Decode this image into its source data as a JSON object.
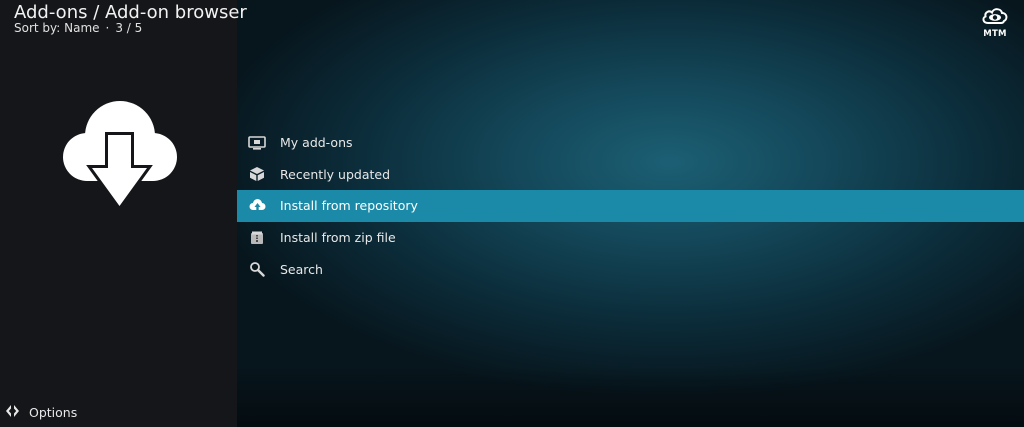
{
  "header": {
    "title": "Add-ons / Add-on browser",
    "sort_label": "Sort by: Name",
    "separator": "·",
    "position": "3 / 5"
  },
  "hero": {
    "icon": "cloud-download-icon"
  },
  "menu": {
    "selected_index": 2,
    "items": [
      {
        "label": "My add-ons",
        "icon": "monitor-box-icon"
      },
      {
        "label": "Recently updated",
        "icon": "package-box-icon"
      },
      {
        "label": "Install from repository",
        "icon": "cloud-upload-icon"
      },
      {
        "label": "Install from zip file",
        "icon": "zip-archive-icon"
      },
      {
        "label": "Search",
        "icon": "magnifier-icon"
      }
    ]
  },
  "footer": {
    "options_label": "Options",
    "options_icon": "options-arrows-icon"
  },
  "logo": {
    "text": "MTM",
    "icon": "eye-cloud-icon"
  },
  "colors": {
    "left_panel": "#141619",
    "selection": "#1a8aa8",
    "background_teal": "#134658"
  }
}
